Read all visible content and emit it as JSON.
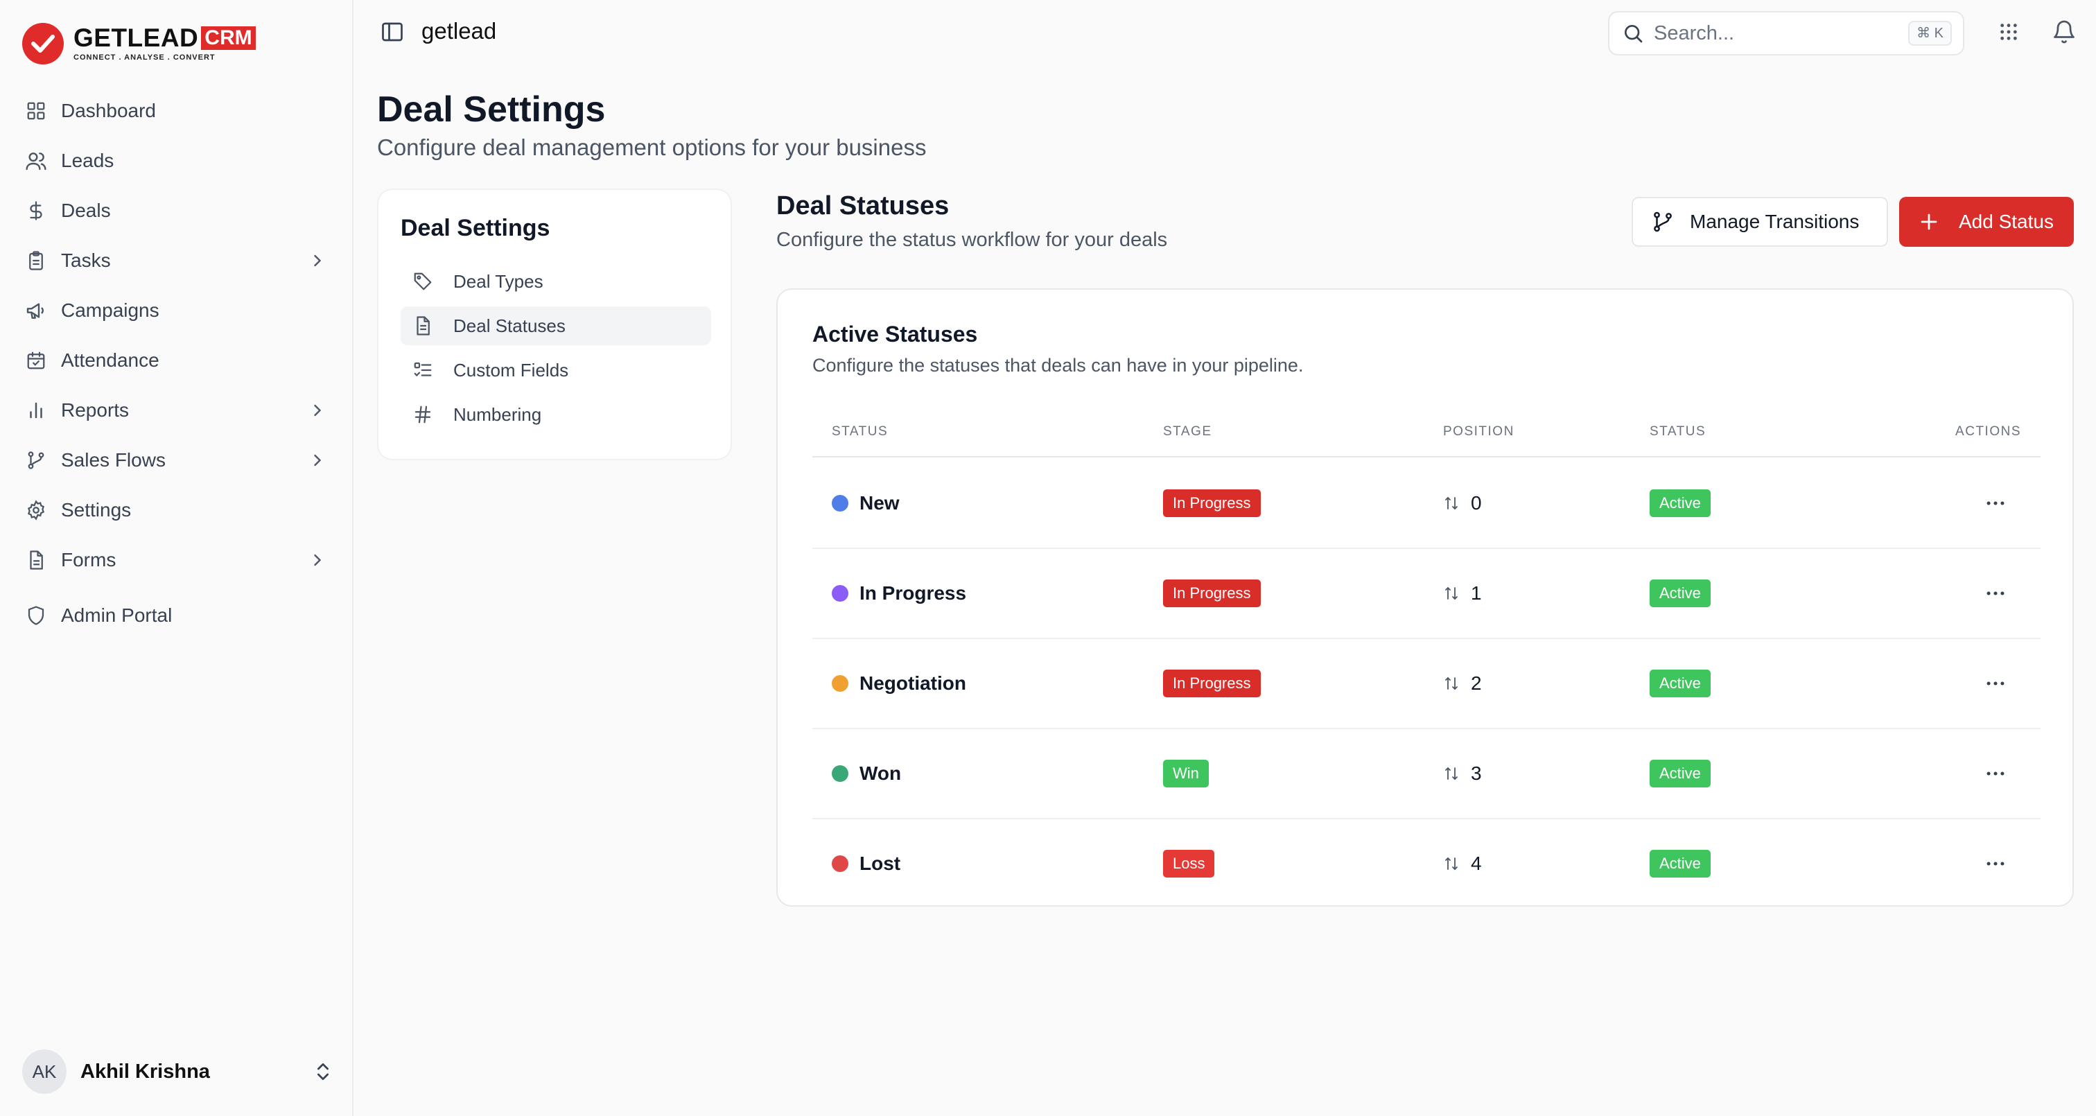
{
  "brand": {
    "word": "GETLEAD",
    "crm": "CRM",
    "tagline": "CONNECT . ANALYSE . CONVERT"
  },
  "sidebar": {
    "items": [
      {
        "label": "Dashboard",
        "icon": "dashboard-icon",
        "chevron": false
      },
      {
        "label": "Leads",
        "icon": "users-icon",
        "chevron": false
      },
      {
        "label": "Deals",
        "icon": "dollar-icon",
        "chevron": false
      },
      {
        "label": "Tasks",
        "icon": "clipboard-icon",
        "chevron": true
      },
      {
        "label": "Campaigns",
        "icon": "megaphone-icon",
        "chevron": false
      },
      {
        "label": "Attendance",
        "icon": "calendar-check-icon",
        "chevron": false
      },
      {
        "label": "Reports",
        "icon": "bar-chart-icon",
        "chevron": true
      },
      {
        "label": "Sales Flows",
        "icon": "git-branch-icon",
        "chevron": true
      },
      {
        "label": "Settings",
        "icon": "gear-icon",
        "chevron": false
      },
      {
        "label": "Forms",
        "icon": "file-icon",
        "chevron": true
      },
      {
        "label": "Admin Portal",
        "icon": "shield-icon",
        "chevron": false
      }
    ],
    "user": {
      "initials": "AK",
      "name": "Akhil Krishna"
    }
  },
  "topbar": {
    "breadcrumb": "getlead",
    "search_placeholder": "Search...",
    "search_shortcut": "⌘ K"
  },
  "page": {
    "title": "Deal Settings",
    "subtitle": "Configure deal management options for your business"
  },
  "settings_nav": {
    "title": "Deal Settings",
    "items": [
      {
        "label": "Deal Types",
        "icon": "tag-icon",
        "active": false
      },
      {
        "label": "Deal Statuses",
        "icon": "document-icon",
        "active": true
      },
      {
        "label": "Custom Fields",
        "icon": "list-checks-icon",
        "active": false
      },
      {
        "label": "Numbering",
        "icon": "hash-icon",
        "active": false
      }
    ]
  },
  "main": {
    "title": "Deal Statuses",
    "subtitle": "Configure the status workflow for your deals",
    "manage_button": "Manage Transitions",
    "add_button": "Add Status"
  },
  "table": {
    "title": "Active Statuses",
    "subtitle": "Configure the statuses that deals can have in your pipeline.",
    "headers": {
      "status": "STATUS",
      "stage": "STAGE",
      "position": "POSITION",
      "state": "STATUS",
      "actions": "ACTIONS"
    },
    "rows": [
      {
        "name": "New",
        "dot_color": "#4f7ee8",
        "stage": "In Progress",
        "stage_color": "#d92d2a",
        "position": "0",
        "state": "Active"
      },
      {
        "name": "In Progress",
        "dot_color": "#8b5cf6",
        "stage": "In Progress",
        "stage_color": "#d92d2a",
        "position": "1",
        "state": "Active"
      },
      {
        "name": "Negotiation",
        "dot_color": "#f0a030",
        "stage": "In Progress",
        "stage_color": "#d92d2a",
        "position": "2",
        "state": "Active"
      },
      {
        "name": "Won",
        "dot_color": "#3aa876",
        "stage": "Win",
        "stage_color": "#3fc55e",
        "position": "3",
        "state": "Active"
      },
      {
        "name": "Lost",
        "dot_color": "#e04848",
        "stage": "Loss",
        "stage_color": "#e53935",
        "position": "4",
        "state": "Active"
      }
    ],
    "active_color": "#3fc55e"
  }
}
